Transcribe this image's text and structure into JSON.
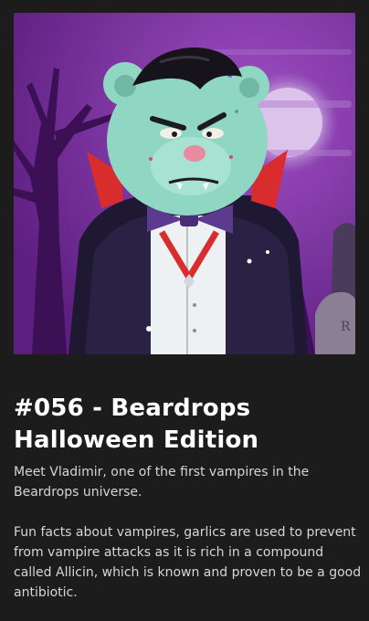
{
  "artwork": {
    "icon": "vampire-bear-nft-illustration",
    "tombstone_letter": "R",
    "colors": {
      "background": "#7a2c9c",
      "fur": "#8fd6c3",
      "hair": "#16131a",
      "cape_lining": "#d92c2c",
      "bow_tie": "#5b3a8f",
      "moon": "#c7a4dc"
    }
  },
  "title": {
    "line1": "#056 - Beardrops",
    "line2": "Halloween Edition"
  },
  "description": {
    "p1_line1": "Meet Vladimir, one of the first vampires in the",
    "p1_line2": "Beardrops universe.",
    "p2_line1": "Fun facts about vampires, garlics are used to prevent",
    "p2_line2": "from vampire attacks as it is rich in a compound",
    "p2_line3": "called Allicin, which is known and proven to be a good",
    "p2_line4": "antibiotic."
  }
}
